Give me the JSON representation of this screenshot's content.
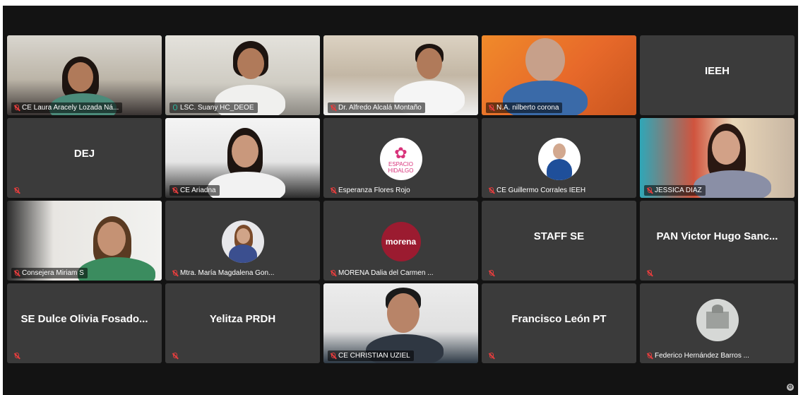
{
  "participants": [
    {
      "name": "CE Laura Aracely Lozada Ná...",
      "muted": true,
      "type": "video"
    },
    {
      "name": "LSC. Suany HC_DEOE",
      "muted": false,
      "type": "video"
    },
    {
      "name": "Dr. Alfredo Alcalá Montaño",
      "muted": true,
      "type": "video"
    },
    {
      "name": "N.A.  nilberto corona",
      "muted": true,
      "type": "video"
    },
    {
      "name": "IEEH",
      "muted": false,
      "type": "text"
    },
    {
      "name": "DEJ",
      "muted": true,
      "type": "text"
    },
    {
      "name": "CE Ariadna",
      "muted": true,
      "type": "video"
    },
    {
      "name": "Esperanza Flores Rojo",
      "muted": true,
      "type": "avatar",
      "logo": "ESPACIO HIDALGO"
    },
    {
      "name": "CE Guillermo Corrales IEEH",
      "muted": true,
      "type": "avatar"
    },
    {
      "name": "JESSICA DIAZ",
      "muted": true,
      "type": "video"
    },
    {
      "name": "Consejera Miriam S",
      "muted": true,
      "type": "video"
    },
    {
      "name": "Mtra. María Magdalena Gon...",
      "muted": true,
      "type": "avatar"
    },
    {
      "name": "MORENA Dalia del Carmen ...",
      "muted": true,
      "type": "avatar",
      "logo": "morena"
    },
    {
      "name": "STAFF SE",
      "muted": true,
      "type": "text"
    },
    {
      "name": "PAN Victor Hugo Sanc...",
      "muted": true,
      "type": "text"
    },
    {
      "name": "SE Dulce Olivia Fosado...",
      "muted": true,
      "type": "text"
    },
    {
      "name": "Yelitza PRDH",
      "muted": true,
      "type": "text"
    },
    {
      "name": "CE CHRISTIAN UZIEL",
      "muted": false,
      "type": "video"
    },
    {
      "name": "Francisco León PT",
      "muted": true,
      "type": "text"
    },
    {
      "name": "Federico Hernández Barros ...",
      "muted": true,
      "type": "avatar"
    }
  ],
  "colors": {
    "background": "#131313",
    "tile": "#3b3b3b",
    "active_speaker": "#2ab8a0",
    "muted_mic": "#e43d3d"
  }
}
